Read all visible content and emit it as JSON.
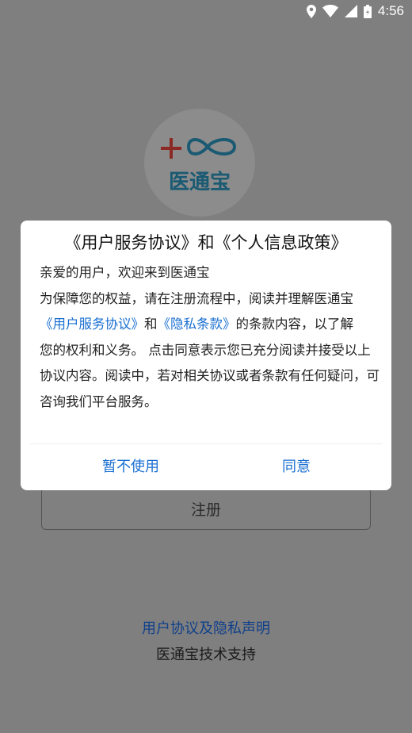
{
  "status_bar": {
    "time": "4:56"
  },
  "logo": {
    "text": "医通宝",
    "mark_color": "#c0392b",
    "infinity_color": "#1b5a73"
  },
  "register_button": {
    "label": "注册"
  },
  "footer": {
    "agreement_link": "用户协议及隐私声明",
    "support": "医通宝技术支持"
  },
  "dialog": {
    "title": "《用户服务协议》和《个人信息政策》",
    "greeting": "亲爱的用户，欢迎来到医通宝",
    "line1": "为保障您的权益，请在注册流程中，阅读并理解医通宝",
    "link_service": "《用户服务协议》",
    "and_text": "和",
    "link_privacy": "《隐私条款》",
    "after_links": "的条款内容，以了解",
    "rest": "您的权利和义务。 点击同意表示您已充分阅读并接受以上协议内容。阅读中，若对相关协议或者条款有任何疑问，可咨询我们平台服务。",
    "cancel_label": "暂不使用",
    "agree_label": "同意"
  }
}
